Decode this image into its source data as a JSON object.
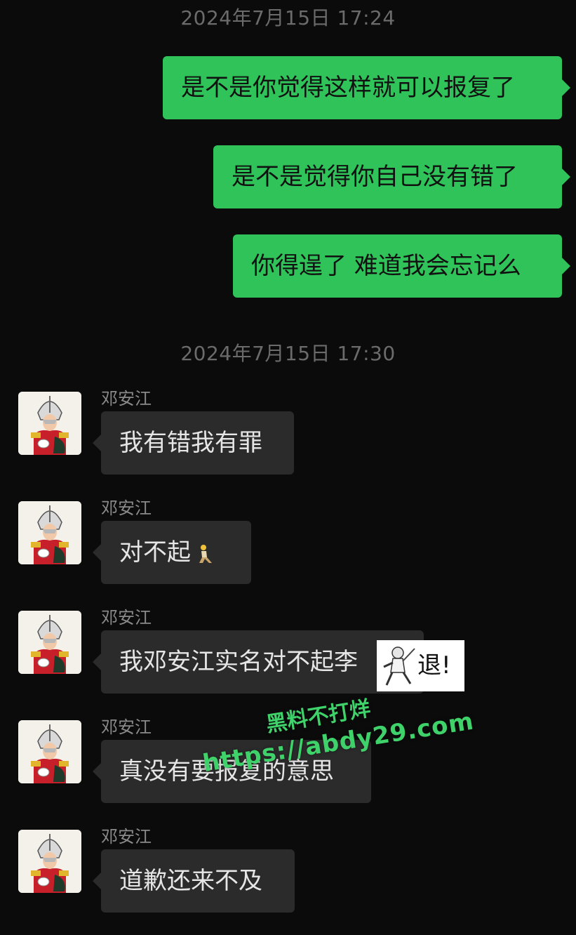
{
  "timestamps": [
    "2024年7月15日 17:24",
    "2024年7月15日 17:30"
  ],
  "outgoing": [
    {
      "text": "是不是你觉得这样就可以报复了"
    },
    {
      "text": "是不是觉得你自己没有错了"
    },
    {
      "text": "你得逞了 难道我会忘记么"
    }
  ],
  "incoming": [
    {
      "sender": "邓安江",
      "text": "我有错我有罪"
    },
    {
      "sender": "邓安江",
      "text": "对不起"
    },
    {
      "sender": "邓安江",
      "text": "我邓安江实名对不起李"
    },
    {
      "sender": "邓安江",
      "text": "真没有要报复的意思"
    },
    {
      "sender": "邓安江",
      "text": "道歉还来不及"
    }
  ],
  "sticker": {
    "text": "退!"
  },
  "watermark": {
    "line1": "黑料不打烊",
    "line2": "https://abdy29.com"
  },
  "colors": {
    "background": "#0b0b0b",
    "outgoing_bubble": "#2fc35a",
    "incoming_bubble": "#2b2b2b",
    "timestamp": "#6b6b6b",
    "sender": "#8a8a8a",
    "watermark": "#3fd16a"
  },
  "icons": {
    "avatar": "anime-soldier-avatar",
    "emoji": "person-kneeling-emoji",
    "sticker": "fencer-sticker"
  }
}
